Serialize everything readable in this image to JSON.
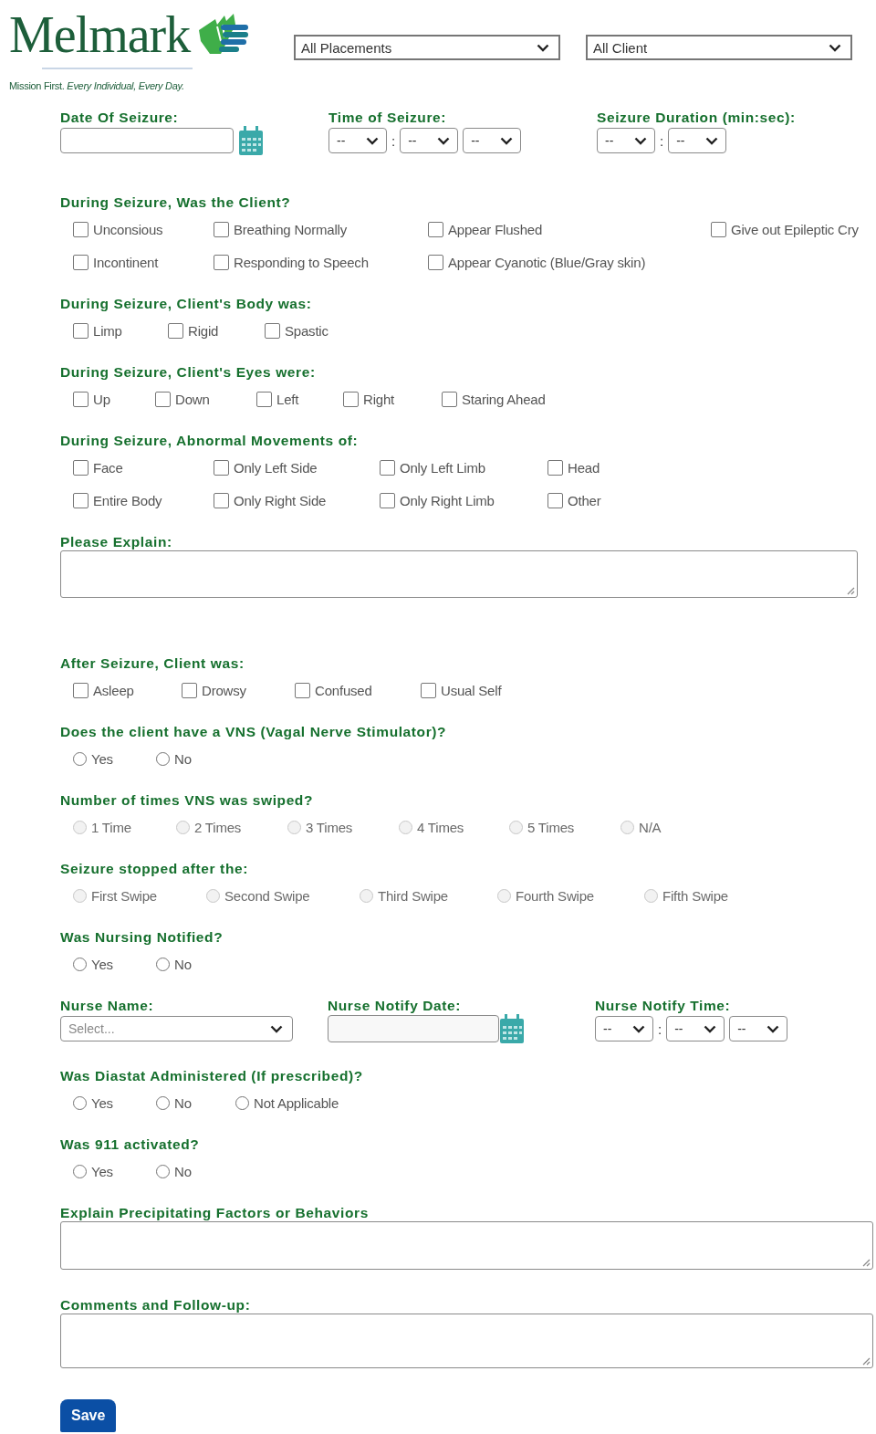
{
  "header": {
    "logo": "Melmark",
    "tagline": "Mission First. *Every Individual, Every Day.*",
    "filters": [
      {
        "value": "All Placements"
      },
      {
        "value": "All Client"
      }
    ]
  },
  "sections": [
    {
      "kind": "fields",
      "fields": [
        {
          "kind": "date",
          "label": "Date Of Seizure:"
        },
        {
          "kind": "time",
          "label": "Time of Seizure:",
          "parts": [
            {
              "kind": "select",
              "value": "--"
            },
            {
              "kind": "sep",
              "text": ":"
            },
            {
              "kind": "select",
              "value": "--"
            },
            {
              "kind": "select",
              "value": "--"
            }
          ]
        },
        {
          "kind": "time",
          "label": "Seizure Duration (min:sec):",
          "parts": [
            {
              "kind": "select",
              "value": "--"
            },
            {
              "kind": "sep",
              "text": ":"
            },
            {
              "kind": "select",
              "value": "--"
            }
          ]
        }
      ]
    },
    {
      "kind": "checkboxes",
      "label": "During Seizure, Was the Client?",
      "rows": [
        [
          {
            "label": "Unconsious",
            "checked": false
          },
          {
            "label": "Breathing Normally",
            "checked": false
          },
          {
            "label": "Appear Flushed",
            "checked": false
          },
          {
            "label": "Give out Epileptic Cry",
            "checked": false
          }
        ],
        [
          {
            "label": "Incontinent",
            "checked": false
          },
          {
            "label": "Responding to Speech",
            "checked": false
          },
          {
            "label": "Appear Cyanotic (Blue/Gray skin)",
            "checked": false
          }
        ]
      ]
    },
    {
      "kind": "checkboxes",
      "label": "During Seizure, Client's Body was:",
      "rows": [
        [
          {
            "label": "Limp",
            "checked": false
          },
          {
            "label": "Rigid",
            "checked": false
          },
          {
            "label": "Spastic",
            "checked": false
          }
        ]
      ]
    },
    {
      "kind": "checkboxes",
      "label": "During Seizure, Client's Eyes were:",
      "rows": [
        [
          {
            "label": "Up",
            "checked": false
          },
          {
            "label": "Down",
            "checked": false
          },
          {
            "label": "Left",
            "checked": false
          },
          {
            "label": "Right",
            "checked": false
          },
          {
            "label": "Staring Ahead",
            "checked": false
          }
        ]
      ]
    },
    {
      "kind": "checkboxes",
      "label": "During Seizure, Abnormal Movements of:",
      "rows": [
        [
          {
            "label": "Face",
            "checked": false
          },
          {
            "label": "Only Left Side",
            "checked": false
          },
          {
            "label": "Only Left Limb",
            "checked": false
          },
          {
            "label": "Head",
            "checked": false
          }
        ],
        [
          {
            "label": "Entire Body",
            "checked": false
          },
          {
            "label": "Only Right Side",
            "checked": false
          },
          {
            "label": "Only Right Limb",
            "checked": false
          },
          {
            "label": "Other",
            "checked": false
          }
        ]
      ]
    },
    {
      "kind": "textarea",
      "label": "Please Explain:"
    },
    {
      "kind": "checkboxes",
      "label": "After Seizure, Client was:",
      "rows": [
        [
          {
            "label": "Asleep",
            "checked": false
          },
          {
            "label": "Drowsy",
            "checked": false
          },
          {
            "label": "Confused",
            "checked": false
          },
          {
            "label": "Usual Self",
            "checked": false
          }
        ]
      ]
    },
    {
      "kind": "radios",
      "label": "Does the client have a VNS (Vagal Nerve Stimulator)?",
      "options": [
        {
          "label": "Yes",
          "selected": false,
          "disabled": false
        },
        {
          "label": "No",
          "selected": false,
          "disabled": false
        }
      ]
    },
    {
      "kind": "radios",
      "label": "Number of times VNS was swiped?",
      "options": [
        {
          "label": "1 Time",
          "selected": false,
          "disabled": true
        },
        {
          "label": "2 Times",
          "selected": false,
          "disabled": true
        },
        {
          "label": "3 Times",
          "selected": false,
          "disabled": true
        },
        {
          "label": "4 Times",
          "selected": false,
          "disabled": true
        },
        {
          "label": "5 Times",
          "selected": false,
          "disabled": true
        },
        {
          "label": "N/A",
          "selected": false,
          "disabled": true
        }
      ]
    },
    {
      "kind": "radios",
      "label": "Seizure stopped after the:",
      "options": [
        {
          "label": "First Swipe",
          "selected": false,
          "disabled": true
        },
        {
          "label": "Second Swipe",
          "selected": false,
          "disabled": true
        },
        {
          "label": "Third Swipe",
          "selected": false,
          "disabled": true
        },
        {
          "label": "Fourth Swipe",
          "selected": false,
          "disabled": true
        },
        {
          "label": "Fifth Swipe",
          "selected": false,
          "disabled": true
        }
      ]
    },
    {
      "kind": "radios",
      "label": "Was Nursing Notified?",
      "options": [
        {
          "label": "Yes",
          "selected": false,
          "disabled": false
        },
        {
          "label": "No",
          "selected": false,
          "disabled": false
        }
      ]
    },
    {
      "kind": "fields",
      "fields": [
        {
          "kind": "dropdown",
          "label": "Nurse Name:",
          "placeholder": "Select..."
        },
        {
          "kind": "date",
          "label": "Nurse Notify Date:"
        },
        {
          "kind": "time",
          "label": "Nurse Notify Time:",
          "parts": [
            {
              "kind": "select",
              "value": "--"
            },
            {
              "kind": "sep",
              "text": ":"
            },
            {
              "kind": "select",
              "value": "--"
            },
            {
              "kind": "select",
              "value": "--"
            }
          ]
        }
      ]
    },
    {
      "kind": "radios",
      "label": "Was Diastat Administered (If prescribed)?",
      "options": [
        {
          "label": "Yes",
          "selected": false,
          "disabled": false
        },
        {
          "label": "No",
          "selected": false,
          "disabled": false
        },
        {
          "label": "Not Applicable",
          "selected": false,
          "disabled": false
        }
      ]
    },
    {
      "kind": "radios",
      "label": "Was 911 activated?",
      "options": [
        {
          "label": "Yes",
          "selected": false,
          "disabled": false
        },
        {
          "label": "No",
          "selected": false,
          "disabled": false
        }
      ]
    },
    {
      "kind": "textarea",
      "label": "Explain Precipitating Factors or Behaviors"
    },
    {
      "kind": "textarea",
      "label": "Comments and Follow-up:"
    }
  ],
  "save": "Save"
}
